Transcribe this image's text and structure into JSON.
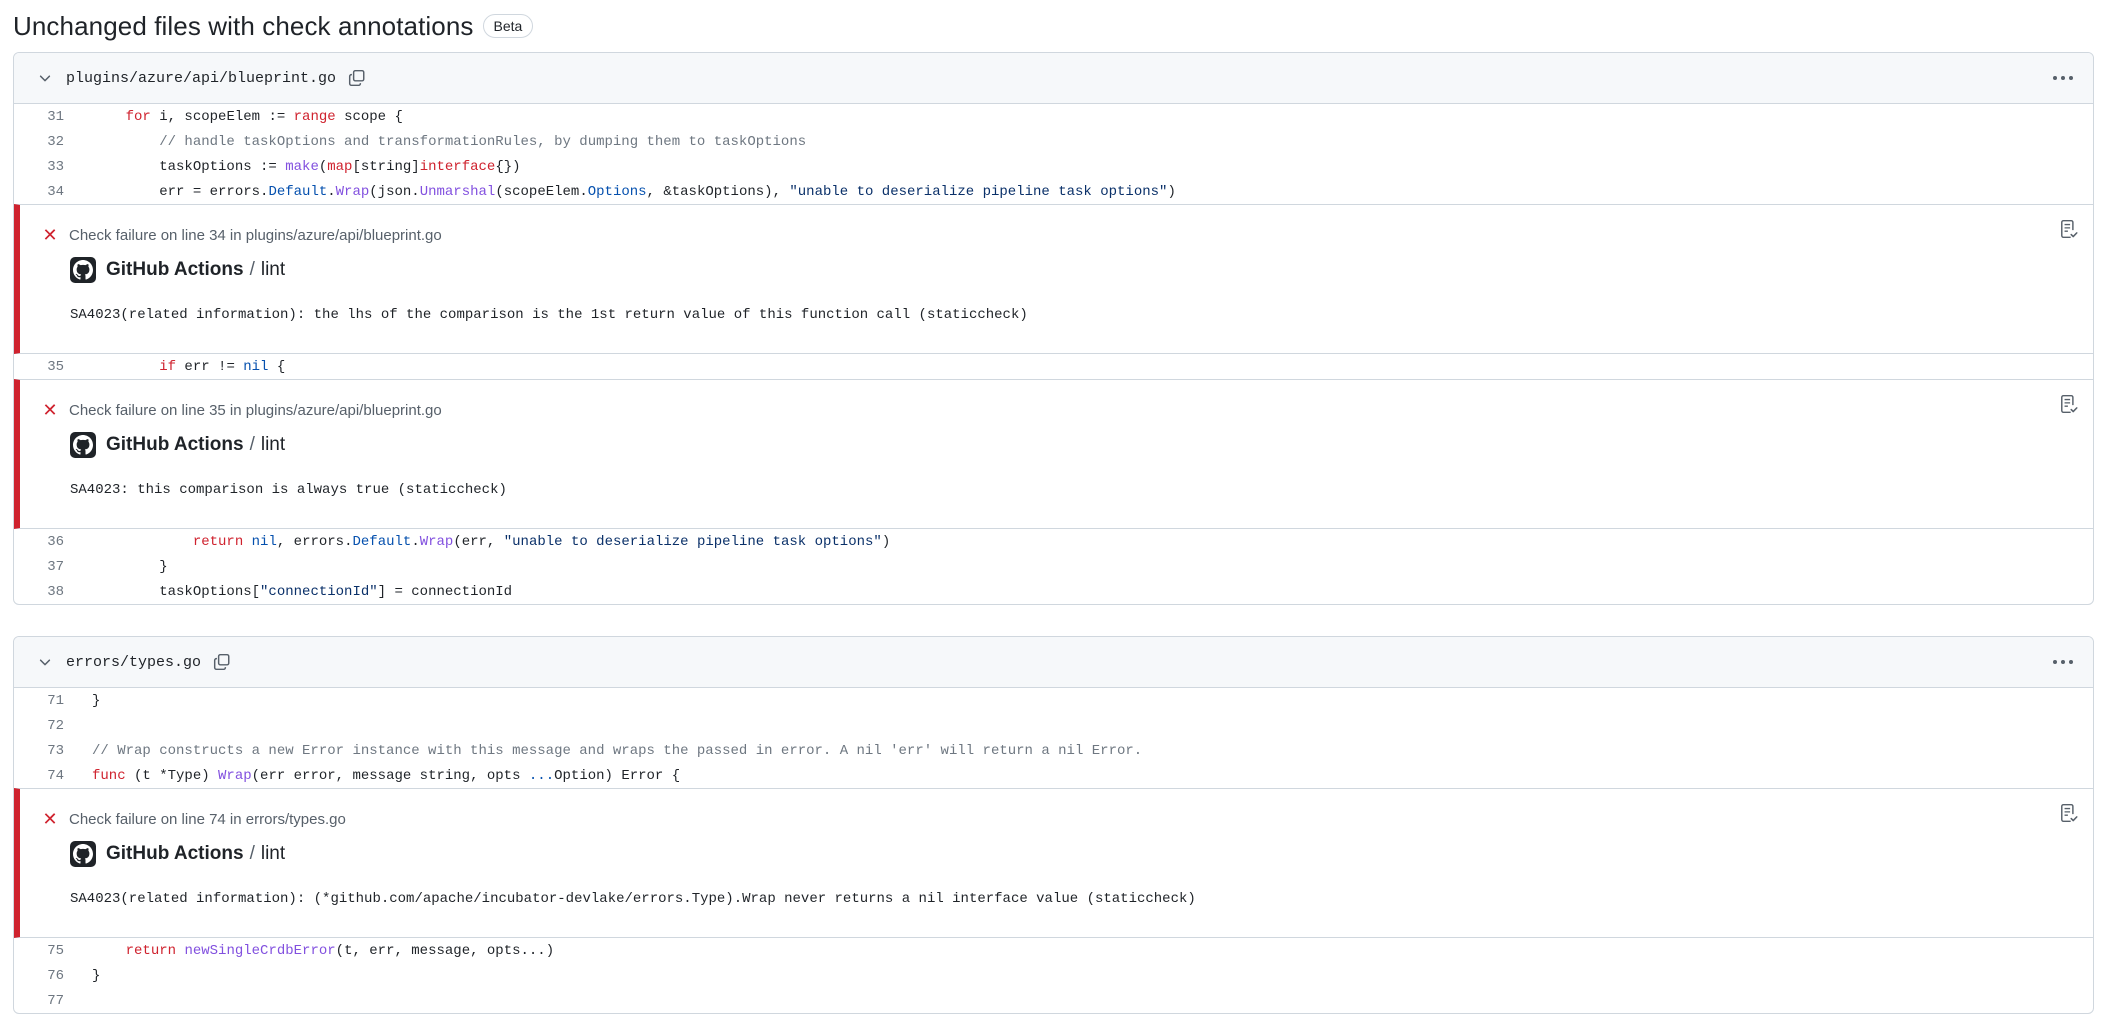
{
  "heading": {
    "title": "Unchanged files with check annotations",
    "badge": "Beta"
  },
  "files": [
    {
      "name": "plugins/azure/api/blueprint.go",
      "lines": [
        {
          "num": "31",
          "code": "    for i, scopeElem := range scope {"
        },
        {
          "num": "32",
          "code": "        // handle taskOptions and transformationRules, by dumping them to taskOptions"
        },
        {
          "num": "33",
          "code": "        taskOptions := make(map[string]interface{})"
        },
        {
          "num": "34",
          "code": "        err = errors.Default.Wrap(json.Unmarshal(scopeElem.Options, &taskOptions), \"unable to deserialize pipeline task options\")"
        },
        {
          "num": "35",
          "code": "        if err != nil {"
        },
        {
          "num": "36",
          "code": "            return nil, errors.Default.Wrap(err, \"unable to deserialize pipeline task options\")"
        },
        {
          "num": "37",
          "code": "        }"
        },
        {
          "num": "38",
          "code": "        taskOptions[\"connectionId\"] = connectionId"
        }
      ],
      "annotations": [
        {
          "title": "Check failure on line 34 in plugins/azure/api/blueprint.go",
          "source": "GitHub Actions",
          "sep": "/",
          "job": "lint",
          "message": "SA4023(related information): the lhs of the comparison is the 1st return value of this function call (staticcheck)"
        },
        {
          "title": "Check failure on line 35 in plugins/azure/api/blueprint.go",
          "source": "GitHub Actions",
          "sep": "/",
          "job": "lint",
          "message": "SA4023: this comparison is always true (staticcheck)"
        }
      ]
    },
    {
      "name": "errors/types.go",
      "lines": [
        {
          "num": "71",
          "code": "}"
        },
        {
          "num": "72",
          "code": ""
        },
        {
          "num": "73",
          "code": "// Wrap constructs a new Error instance with this message and wraps the passed in error. A nil 'err' will return a nil Error."
        },
        {
          "num": "74",
          "code": "func (t *Type) Wrap(err error, message string, opts ...Option) Error {"
        },
        {
          "num": "75",
          "code": "    return newSingleCrdbError(t, err, message, opts...)"
        },
        {
          "num": "76",
          "code": "}"
        },
        {
          "num": "77",
          "code": ""
        }
      ],
      "annotations": [
        {
          "title": "Check failure on line 74 in errors/types.go",
          "source": "GitHub Actions",
          "sep": "/",
          "job": "lint",
          "message": "SA4023(related information): (*github.com/apache/incubator-devlake/errors.Type).Wrap never returns a nil interface value (staticcheck)"
        }
      ]
    }
  ],
  "icons": {
    "collapse": "chevron-down-icon",
    "copy": "copy-icon",
    "more": "kebab-horizontal-icon",
    "failure": "x-icon",
    "app": "github-logo-icon",
    "annotation_action": "file-check-icon"
  },
  "colors": {
    "failure": "#cf222e",
    "keyword": "#cf222e",
    "function": "#8250df",
    "constant": "#0550ae",
    "string": "#0a3069",
    "comment": "#6e7781"
  }
}
